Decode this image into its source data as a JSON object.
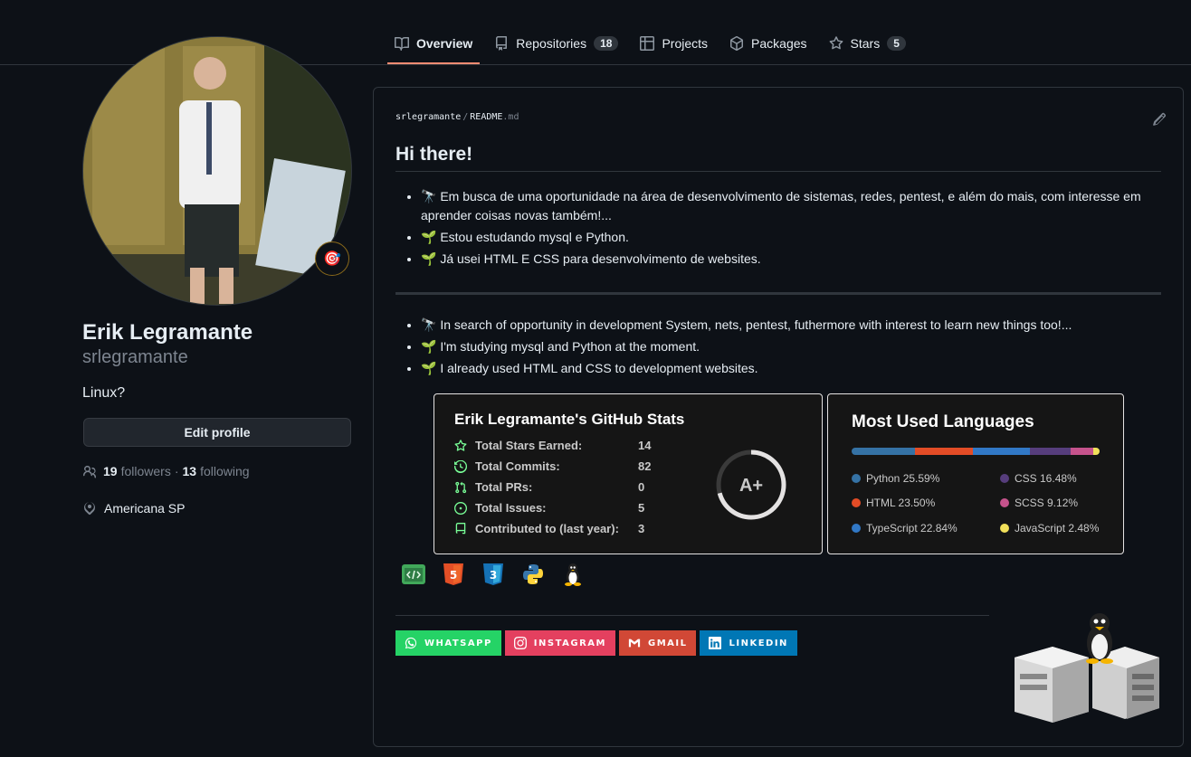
{
  "nav": {
    "tabs": [
      {
        "label": "Overview",
        "active": true
      },
      {
        "label": "Repositories",
        "count": "18"
      },
      {
        "label": "Projects"
      },
      {
        "label": "Packages"
      },
      {
        "label": "Stars",
        "count": "5"
      }
    ]
  },
  "profile": {
    "full_name": "Erik Legramante",
    "login": "srlegramante",
    "bio": "Linux?",
    "status_emoji": "🎯",
    "edit_label": "Edit profile",
    "followers_count": "19",
    "followers_label": "followers",
    "following_count": "13",
    "following_label": "following",
    "location": "Americana SP"
  },
  "readme": {
    "owner": "srlegramante",
    "file": "README",
    "ext": ".md",
    "heading": "Hi there!",
    "list_pt": [
      "🔭 Em busca de uma oportunidade na área de desenvolvimento de sistemas, redes, pentest, e além do mais, com interesse em aprender coisas novas também!...",
      "🌱 Estou estudando mysql e Python.",
      "🌱 Já usei HTML E CSS para desenvolvimento de websites."
    ],
    "list_en": [
      "🔭 In search of opportunity in development System, nets, pentest, futhermore with interest to learn new things too!...",
      "🌱 I'm studying mysql and Python at the moment.",
      "🌱 I already used HTML and CSS to development websites."
    ]
  },
  "stats": {
    "title": "Erik Legramante's GitHub Stats",
    "rows": [
      {
        "label": "Total Stars Earned:",
        "value": "14"
      },
      {
        "label": "Total Commits:",
        "value": "82"
      },
      {
        "label": "Total PRs:",
        "value": "0"
      },
      {
        "label": "Total Issues:",
        "value": "5"
      },
      {
        "label": "Contributed to (last year):",
        "value": "3"
      }
    ],
    "grade": "A+"
  },
  "languages": {
    "title": "Most Used Languages",
    "items": [
      {
        "label": "Python 25.59%",
        "pct": 25.59,
        "color": "#3572a5"
      },
      {
        "label": "CSS 16.48%",
        "pct": 16.48,
        "color": "#563d7c"
      },
      {
        "label": "HTML 23.50%",
        "pct": 23.5,
        "color": "#e34c26"
      },
      {
        "label": "SCSS 9.12%",
        "pct": 9.12,
        "color": "#c6538c"
      },
      {
        "label": "TypeScript 22.84%",
        "pct": 22.84,
        "color": "#3178c6"
      },
      {
        "label": "JavaScript 2.48%",
        "pct": 2.48,
        "color": "#f1e05a"
      }
    ]
  },
  "badges": [
    {
      "label": "WHATSAPP",
      "color": "#25d366",
      "icon": "whatsapp-icon"
    },
    {
      "label": "INSTAGRAM",
      "color": "#e4405f",
      "icon": "instagram-icon"
    },
    {
      "label": "GMAIL",
      "color": "#d14836",
      "icon": "gmail-icon"
    },
    {
      "label": "LINKEDIN",
      "color": "#0077b5",
      "icon": "linkedin-icon"
    }
  ]
}
